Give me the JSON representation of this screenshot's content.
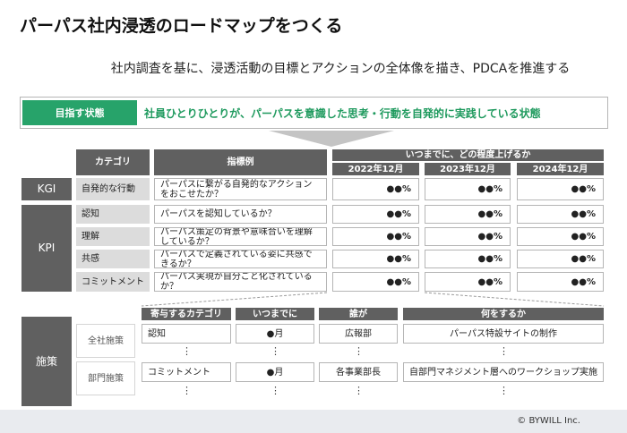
{
  "title": "パーパス社内浸透のロードマップをつくる",
  "subtitle": "社内調査を基に、浸透活動の目標とアクションの全体像を描き、PDCAを推進する",
  "goal": {
    "label": "目指す状態",
    "text": "社員ひとりひとりが、パーパスを意識した思考・行動を自発的に実践している状態"
  },
  "kpi_table": {
    "header_category": "カテゴリ",
    "header_example": "指標例",
    "header_when": "いつまでに、どの程度上げるか",
    "years": [
      "2022年12月",
      "2023年12月",
      "2024年12月"
    ],
    "kgi_label": "KGI",
    "kpi_label": "KPI",
    "rows": [
      {
        "category": "自発的な行動",
        "example": "パーパスに繋がる自発的なアクションをおこせたか？",
        "values": [
          "●●%",
          "●●%",
          "●●%"
        ]
      },
      {
        "category": "認知",
        "example": "パーパスを認知しているか？",
        "values": [
          "●●%",
          "●●%",
          "●●%"
        ]
      },
      {
        "category": "理解",
        "example": "パーパス策定の背景や意味合いを理解しているか？",
        "values": [
          "●●%",
          "●●%",
          "●●%"
        ]
      },
      {
        "category": "共感",
        "example": "パーパスで定義されている姿に共感できるか？",
        "values": [
          "●●%",
          "●●%",
          "●●%"
        ]
      },
      {
        "category": "コミットメント",
        "example": "パーパス実現が自分ごと化されているか？",
        "values": [
          "●●%",
          "●●%",
          "●●%"
        ]
      }
    ]
  },
  "measures": {
    "label": "施策",
    "headers": [
      "寄与するカテゴリ",
      "いつまでに",
      "誰が",
      "何をするか"
    ],
    "rows": [
      {
        "group": "全社施策",
        "category": "認知",
        "when": "●月",
        "who": "広報部",
        "what": "パーパス特設サイトの制作"
      },
      {
        "group": "部門施策",
        "category": "コミットメント",
        "when": "●月",
        "who": "各事業部長",
        "what": "自部門マネジメント層へのワークショップ実施"
      }
    ],
    "ellipsis": "⋮"
  },
  "footer": {
    "copyright": "© BYWILL Inc."
  },
  "colors": {
    "accent_green": "#27a36a",
    "dark_gray": "#606060",
    "light_gray": "#dcdcdc"
  }
}
